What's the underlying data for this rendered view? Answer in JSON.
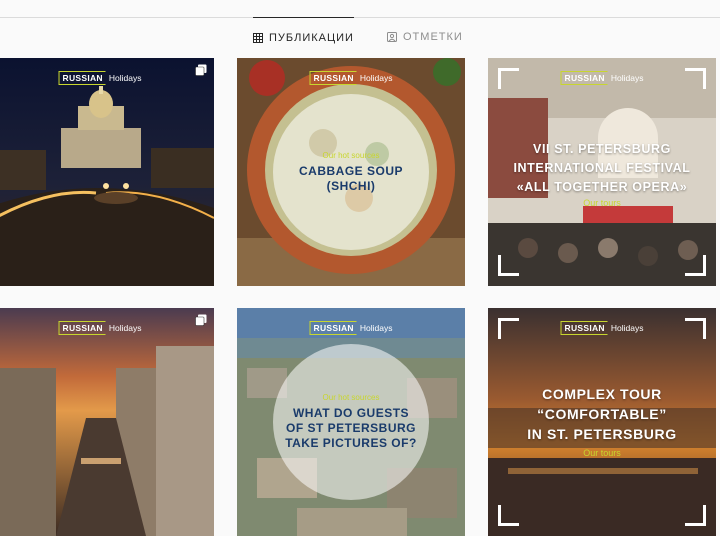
{
  "tabs": [
    {
      "label": "ПУБЛИКАЦИИ",
      "icon": "grid-icon",
      "active": true
    },
    {
      "label": "ОТМЕТКИ",
      "icon": "tagged-icon",
      "active": false
    }
  ],
  "brand": {
    "mark": "RUSSIAN",
    "rest": "Holidays",
    "accent": "#c8d62e"
  },
  "posts": [
    {
      "id": "night-square",
      "multi": true
    },
    {
      "sub": "Our hot sources",
      "title_lines": [
        "CABBAGE SOUP",
        "(SHCHI)"
      ]
    },
    {
      "title_lines": [
        "VII ST. PETERSBURG",
        "INTERNATIONAL FESTIVAL",
        "«ALL TOGETHER OPERA»"
      ],
      "sub": "Our tours"
    },
    {
      "id": "sunset-canal",
      "multi": true
    },
    {
      "sub": "Our hot sources",
      "title_lines": [
        "WHAT DO GUESTS",
        "OF ST PETERSBURG",
        "TAKE PICTURES OF?"
      ]
    },
    {
      "title_lines": [
        "COMPLEX TOUR",
        "“COMFORTABLE”",
        "IN ST. PETERSBURG"
      ],
      "sub": "Our tours"
    }
  ]
}
